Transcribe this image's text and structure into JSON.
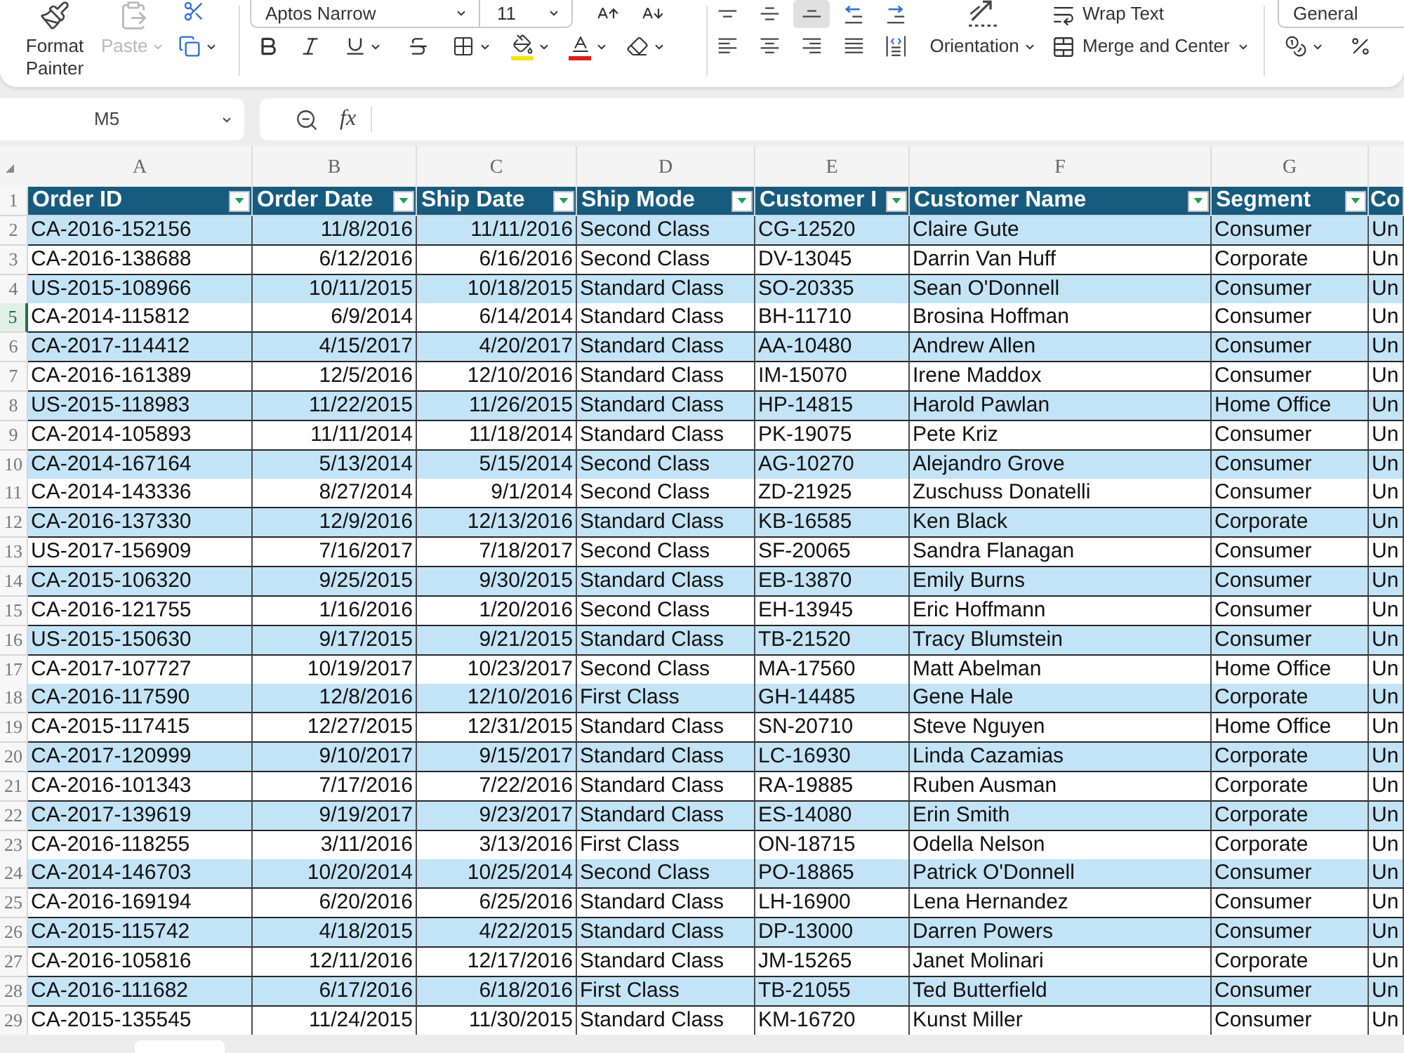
{
  "ribbon": {
    "format_painter": {
      "label": "Format Painter"
    },
    "paste": {
      "label": "Paste",
      "disabled": true
    },
    "font": {
      "name": "Aptos Narrow",
      "size": "11"
    },
    "vertical_alignment": [
      {
        "kind": "top",
        "selected": false
      },
      {
        "kind": "middle",
        "selected": false
      },
      {
        "kind": "bottom",
        "selected": true
      }
    ],
    "horizontal_alignment": [
      {
        "kind": "left",
        "selected": false
      },
      {
        "kind": "center",
        "selected": false
      },
      {
        "kind": "right",
        "selected": false
      },
      {
        "kind": "justify",
        "selected": false
      },
      {
        "kind": "distributed",
        "selected": false
      }
    ],
    "orientation": {
      "label": "Orientation"
    },
    "wrap_text": {
      "label": "Wrap Text"
    },
    "merge": {
      "label": "Merge and Center"
    },
    "number_format": {
      "value": "General"
    }
  },
  "formula_bar": {
    "name_box": "M5",
    "function_label": "fx"
  },
  "sheet": {
    "banded_rows": true,
    "header_row_number": "1",
    "columns": [
      {
        "letter": "A",
        "header": "Order ID",
        "kind": "text",
        "filter": true
      },
      {
        "letter": "B",
        "header": "Order Date",
        "kind": "date",
        "filter": true
      },
      {
        "letter": "C",
        "header": "Ship Date",
        "kind": "date",
        "filter": true
      },
      {
        "letter": "D",
        "header": "Ship Mode",
        "kind": "text",
        "filter": true
      },
      {
        "letter": "E",
        "header": "Customer I",
        "kind": "text",
        "filter": true
      },
      {
        "letter": "F",
        "header": "Customer Name",
        "kind": "text",
        "filter": true
      },
      {
        "letter": "G",
        "header": "Segment",
        "kind": "text",
        "filter": true
      },
      {
        "header": "Co",
        "kind": "text",
        "filter": false
      }
    ],
    "rows": [
      {
        "number": "2",
        "selected": false,
        "cells": [
          "CA-2016-152156",
          "11/8/2016",
          "11/11/2016",
          "Second Class",
          "CG-12520",
          "Claire Gute",
          "Consumer",
          "Un"
        ]
      },
      {
        "number": "3",
        "selected": false,
        "cells": [
          "CA-2016-138688",
          "6/12/2016",
          "6/16/2016",
          "Second Class",
          "DV-13045",
          "Darrin Van Huff",
          "Corporate",
          "Un"
        ]
      },
      {
        "number": "4",
        "selected": false,
        "cells": [
          "US-2015-108966",
          "10/11/2015",
          "10/18/2015",
          "Standard Class",
          "SO-20335",
          "Sean O'Donnell",
          "Consumer",
          "Un"
        ]
      },
      {
        "number": "5",
        "selected": true,
        "cells": [
          "CA-2014-115812",
          "6/9/2014",
          "6/14/2014",
          "Standard Class",
          "BH-11710",
          "Brosina Hoffman",
          "Consumer",
          "Un"
        ]
      },
      {
        "number": "6",
        "selected": false,
        "cells": [
          "CA-2017-114412",
          "4/15/2017",
          "4/20/2017",
          "Standard Class",
          "AA-10480",
          "Andrew Allen",
          "Consumer",
          "Un"
        ]
      },
      {
        "number": "7",
        "selected": false,
        "cells": [
          "CA-2016-161389",
          "12/5/2016",
          "12/10/2016",
          "Standard Class",
          "IM-15070",
          "Irene Maddox",
          "Consumer",
          "Un"
        ]
      },
      {
        "number": "8",
        "selected": false,
        "cells": [
          "US-2015-118983",
          "11/22/2015",
          "11/26/2015",
          "Standard Class",
          "HP-14815",
          "Harold Pawlan",
          "Home Office",
          "Un"
        ]
      },
      {
        "number": "9",
        "selected": false,
        "cells": [
          "CA-2014-105893",
          "11/11/2014",
          "11/18/2014",
          "Standard Class",
          "PK-19075",
          "Pete Kriz",
          "Consumer",
          "Un"
        ]
      },
      {
        "number": "10",
        "selected": false,
        "cells": [
          "CA-2014-167164",
          "5/13/2014",
          "5/15/2014",
          "Second Class",
          "AG-10270",
          "Alejandro Grove",
          "Consumer",
          "Un"
        ]
      },
      {
        "number": "11",
        "selected": false,
        "cells": [
          "CA-2014-143336",
          "8/27/2014",
          "9/1/2014",
          "Second Class",
          "ZD-21925",
          "Zuschuss Donatelli",
          "Consumer",
          "Un"
        ]
      },
      {
        "number": "12",
        "selected": false,
        "cells": [
          "CA-2016-137330",
          "12/9/2016",
          "12/13/2016",
          "Standard Class",
          "KB-16585",
          "Ken Black",
          "Corporate",
          "Un"
        ]
      },
      {
        "number": "13",
        "selected": false,
        "cells": [
          "US-2017-156909",
          "7/16/2017",
          "7/18/2017",
          "Second Class",
          "SF-20065",
          "Sandra Flanagan",
          "Consumer",
          "Un"
        ]
      },
      {
        "number": "14",
        "selected": false,
        "cells": [
          "CA-2015-106320",
          "9/25/2015",
          "9/30/2015",
          "Standard Class",
          "EB-13870",
          "Emily Burns",
          "Consumer",
          "Un"
        ]
      },
      {
        "number": "15",
        "selected": false,
        "cells": [
          "CA-2016-121755",
          "1/16/2016",
          "1/20/2016",
          "Second Class",
          "EH-13945",
          "Eric Hoffmann",
          "Consumer",
          "Un"
        ]
      },
      {
        "number": "16",
        "selected": false,
        "cells": [
          "US-2015-150630",
          "9/17/2015",
          "9/21/2015",
          "Standard Class",
          "TB-21520",
          "Tracy Blumstein",
          "Consumer",
          "Un"
        ]
      },
      {
        "number": "17",
        "selected": false,
        "cells": [
          "CA-2017-107727",
          "10/19/2017",
          "10/23/2017",
          "Second Class",
          "MA-17560",
          "Matt Abelman",
          "Home Office",
          "Un"
        ]
      },
      {
        "number": "18",
        "selected": false,
        "cells": [
          "CA-2016-117590",
          "12/8/2016",
          "12/10/2016",
          "First Class",
          "GH-14485",
          "Gene Hale",
          "Corporate",
          "Un"
        ]
      },
      {
        "number": "19",
        "selected": false,
        "cells": [
          "CA-2015-117415",
          "12/27/2015",
          "12/31/2015",
          "Standard Class",
          "SN-20710",
          "Steve Nguyen",
          "Home Office",
          "Un"
        ]
      },
      {
        "number": "20",
        "selected": false,
        "cells": [
          "CA-2017-120999",
          "9/10/2017",
          "9/15/2017",
          "Standard Class",
          "LC-16930",
          "Linda Cazamias",
          "Corporate",
          "Un"
        ]
      },
      {
        "number": "21",
        "selected": false,
        "cells": [
          "CA-2016-101343",
          "7/17/2016",
          "7/22/2016",
          "Standard Class",
          "RA-19885",
          "Ruben Ausman",
          "Corporate",
          "Un"
        ]
      },
      {
        "number": "22",
        "selected": false,
        "cells": [
          "CA-2017-139619",
          "9/19/2017",
          "9/23/2017",
          "Standard Class",
          "ES-14080",
          "Erin Smith",
          "Corporate",
          "Un"
        ]
      },
      {
        "number": "23",
        "selected": false,
        "cells": [
          "CA-2016-118255",
          "3/11/2016",
          "3/13/2016",
          "First Class",
          "ON-18715",
          "Odella Nelson",
          "Corporate",
          "Un"
        ]
      },
      {
        "number": "24",
        "selected": false,
        "cells": [
          "CA-2014-146703",
          "10/20/2014",
          "10/25/2014",
          "Second Class",
          "PO-18865",
          "Patrick O'Donnell",
          "Consumer",
          "Un"
        ]
      },
      {
        "number": "25",
        "selected": false,
        "cells": [
          "CA-2016-169194",
          "6/20/2016",
          "6/25/2016",
          "Standard Class",
          "LH-16900",
          "Lena Hernandez",
          "Consumer",
          "Un"
        ]
      },
      {
        "number": "26",
        "selected": false,
        "cells": [
          "CA-2015-115742",
          "4/18/2015",
          "4/22/2015",
          "Standard Class",
          "DP-13000",
          "Darren Powers",
          "Consumer",
          "Un"
        ]
      },
      {
        "number": "27",
        "selected": false,
        "cells": [
          "CA-2016-105816",
          "12/11/2016",
          "12/17/2016",
          "Standard Class",
          "JM-15265",
          "Janet Molinari",
          "Corporate",
          "Un"
        ]
      },
      {
        "number": "28",
        "selected": false,
        "cells": [
          "CA-2016-111682",
          "6/17/2016",
          "6/18/2016",
          "First Class",
          "TB-21055",
          "Ted Butterfield",
          "Consumer",
          "Un"
        ]
      },
      {
        "number": "29",
        "selected": false,
        "cells": [
          "CA-2015-135545",
          "11/24/2015",
          "11/30/2015",
          "Standard Class",
          "KM-16720",
          "Kunst Miller",
          "Consumer",
          "Un"
        ]
      }
    ]
  }
}
